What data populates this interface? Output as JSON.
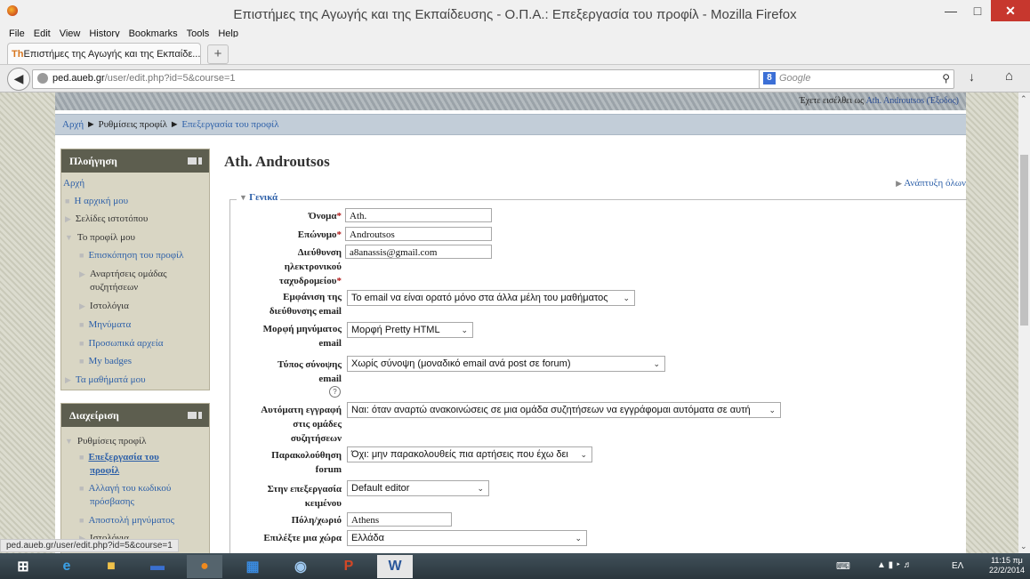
{
  "window": {
    "title": "Επιστήμες της Αγωγής και της Εκπαίδευσης - Ο.Π.Α.: Επεξεργασία του προφίλ - Mozilla Firefox"
  },
  "menu": [
    "File",
    "Edit",
    "View",
    "History",
    "Bookmarks",
    "Tools",
    "Help"
  ],
  "tab": {
    "label": "Επιστήμες της Αγωγής και της Εκπαίδε...",
    "new_tab": "+"
  },
  "nav": {
    "url_host": "ped.aueb.gr",
    "url_path": "/user/edit.php?id=5&course=1",
    "search_placeholder": "Google",
    "status_url": "ped.aueb.gr/user/edit.php?id=5&course=1"
  },
  "header": {
    "login_prefix": "Έχετε εισέλθει ως ",
    "login_user": "Ath. Androutsos",
    "login_logout": "(Έξοδος)"
  },
  "breadcrumb": {
    "home": "Αρχή",
    "sep": "►",
    "settings": "Ρυθμίσεις προφίλ",
    "current": "Επεξεργασία του προφίλ"
  },
  "navblock": {
    "title": "Πλοήγηση",
    "home": "Αρχή",
    "my_home": "Η αρχική μου",
    "site_pages": "Σελίδες ιστοτόπου",
    "my_profile": "Το προφίλ μου",
    "view_profile": "Επισκόπηση του προφίλ",
    "forum_posts_1": "Αναρτήσεις ομάδας",
    "forum_posts_2": "συζητήσεων",
    "blogs": "Ιστολόγια",
    "messages": "Μηνύματα",
    "private_files": "Προσωπικά αρχεία",
    "badges": "My badges",
    "my_courses": "Τα μαθήματά μου"
  },
  "adminblock": {
    "title": "Διαχείριση",
    "profile_settings": "Ρυθμίσεις προφίλ",
    "edit_profile_1": "Επεξεργασία του",
    "edit_profile_2": "προφίλ",
    "change_pw_1": "Αλλαγή του κωδικού",
    "change_pw_2": "πρόσβασης",
    "messaging": "Αποστολή μηνύματος",
    "blogs": "Ιστολόγια"
  },
  "main": {
    "title": "Ath. Androutsos",
    "expand_all": "Ανάπτυξη όλων",
    "legend": "Γενικά",
    "firstname_label": "Όνομα",
    "firstname_value": "Ath.",
    "lastname_label": "Επώνυμο",
    "lastname_value": "Androutsos",
    "email_label_1": "Διεύθυνση",
    "email_label_2": "ηλεκτρονικού",
    "email_label_3": "ταχυδρομείου",
    "email_value": "a8anassis@gmail.com",
    "maildisplay_label_1": "Εμφάνιση της",
    "maildisplay_label_2": "διεύθυνσης email",
    "maildisplay_value": "Το email να είναι ορατό μόνο στα άλλα μέλη του μαθήματος",
    "mailformat_label_1": "Μορφή μηνύματος",
    "mailformat_label_2": "email",
    "mailformat_value": "Μορφή Pretty HTML",
    "maildigest_label_1": "Τύπος σύνοψης",
    "maildigest_label_2": "email",
    "maildigest_value": "Χωρίς σύνοψη (μοναδικό email ανά post σε forum)",
    "autosub_label_1": "Αυτόματη εγγραφή",
    "autosub_label_2": "στις ομάδες",
    "autosub_label_3": "συζητήσεων",
    "autosub_value": "Ναι: όταν αναρτώ ανακοινώσεις σε μια ομάδα συζητήσεων να εγγράφομαι αυτόματα σε αυτή",
    "tracking_label_1": "Παρακολούθηση",
    "tracking_label_2": "forum",
    "tracking_value": "Όχι: μην παρακολουθείς πια αρτήσεις που έχω δει",
    "editor_label_1": "Στην επεξεργασία",
    "editor_label_2": "κειμένου",
    "editor_value": "Default editor",
    "city_label": "Πόλη/χωριό",
    "city_value": "Athens",
    "country_label": "Επιλέξτε μια χώρα",
    "country_value": "Ελλάδα",
    "req": "*"
  },
  "taskbar": {
    "lang": "ΕΛ",
    "time": "11:15 πμ",
    "date": "22/2/2014"
  }
}
